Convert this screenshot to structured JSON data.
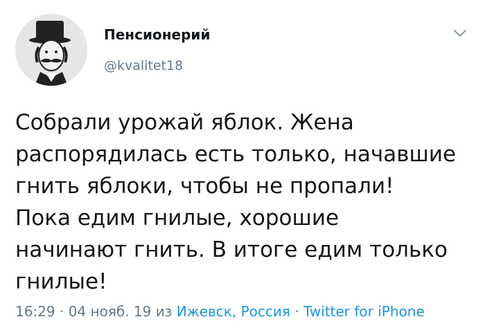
{
  "author": {
    "display_name": "Пенсионерий",
    "handle": "@kvalitet18",
    "avatar_icon": "gentleman-top-hat-avatar"
  },
  "menu": {
    "icon": "chevron-down-icon"
  },
  "tweet": {
    "lines": [
      "Собрали урожай яблок. Жена",
      "распорядилась есть только, начавшие",
      "гнить яблоки, чтобы не пропали!",
      "Пока едим гнилые, хорошие",
      "начинают гнить. В итоге едим только",
      "гнилые!"
    ]
  },
  "meta": {
    "time": "16:29",
    "sep1": " · ",
    "date": "04 нояб. 19",
    "from": " из ",
    "location": "Ижевск, Россия",
    "sep2": " · ",
    "source": "Twitter for iPhone"
  },
  "colors": {
    "text": "#14171a",
    "secondary": "#657786",
    "link": "#1b95e0"
  }
}
